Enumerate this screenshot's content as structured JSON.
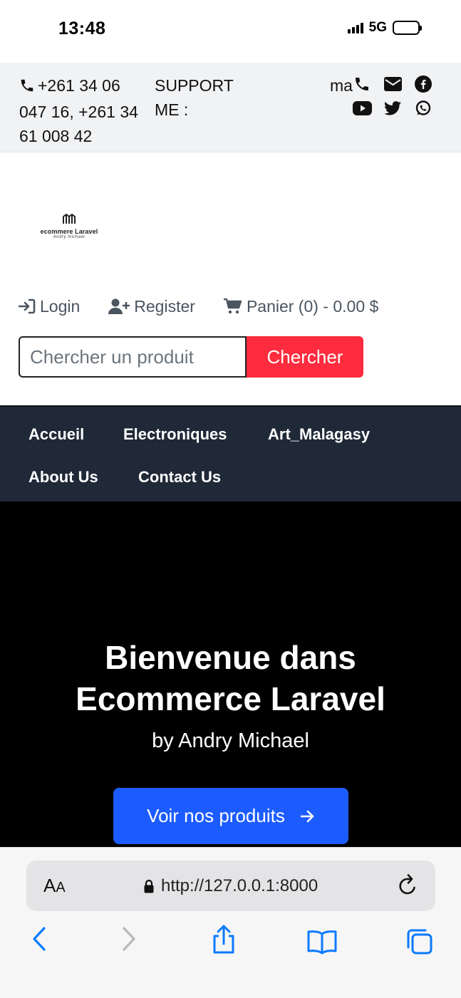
{
  "status_bar": {
    "time": "13:48",
    "network": "5G"
  },
  "topbar": {
    "phone": "+261 34 06 047 16, +261 34 61 008 42",
    "support": "SUPPORT ME :",
    "mail_fragment": "mail"
  },
  "brand": {
    "logo_text": "ecommere Laravel",
    "logo_subtext": "Andry michael"
  },
  "account": {
    "login": "Login",
    "register": "Register",
    "cart": "Panier (0) - 0.00 $"
  },
  "search": {
    "placeholder": "Chercher un produit",
    "button": "Chercher"
  },
  "nav": [
    "Accueil",
    "Electroniques",
    "Art_Malagasy",
    "About Us",
    "Contact Us"
  ],
  "hero": {
    "title": "Bienvenue dans Ecommerce Laravel",
    "subtitle": "by Andry Michael",
    "button": "Voir nos produits"
  },
  "browser": {
    "text_size": "AA",
    "url": "http://127.0.0.1:8000"
  },
  "colors": {
    "search_button": "#fe2c3e",
    "nav_bg": "#1f2937",
    "hero_bg": "#000000",
    "hero_button": "#1c5cff",
    "browser_accent": "#0a7aff"
  }
}
